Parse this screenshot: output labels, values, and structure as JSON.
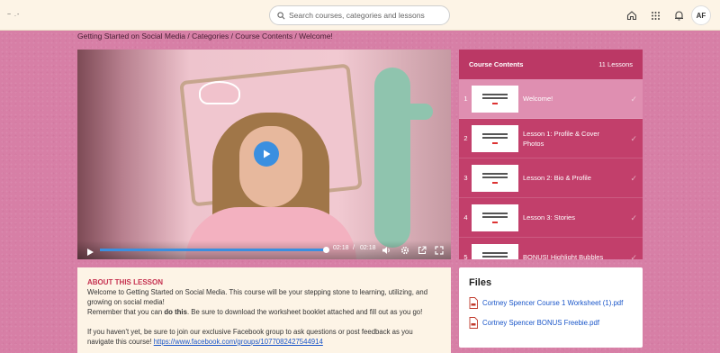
{
  "header": {
    "logo_text": "~ .-",
    "search_placeholder": "Search courses, categories and lessons",
    "avatar_initials": "AF",
    "icons": [
      "home-icon",
      "grid-icon",
      "bell-icon"
    ]
  },
  "breadcrumb": "Getting Started on Social Media / Categories / Course Contents / Welcome!",
  "player": {
    "current_time": "02:18",
    "separator": "/",
    "duration": "02:18",
    "progress": 1.0,
    "accent_color": "#3a8fe0"
  },
  "course_contents": {
    "title": "Course Contents",
    "count": "11 Lessons",
    "lessons": [
      {
        "num": "1",
        "title": "Welcome!",
        "active": true
      },
      {
        "num": "2",
        "title": "Lesson 1: Profile & Cover Photos",
        "active": false
      },
      {
        "num": "3",
        "title": "Lesson 2: Bio & Profile",
        "active": false
      },
      {
        "num": "4",
        "title": "Lesson 3: Stories",
        "active": false
      },
      {
        "num": "5",
        "title": "BONUS! Highlight Bubbles",
        "active": false
      }
    ]
  },
  "about": {
    "title": "ABOUT THIS LESSON",
    "p1": "Welcome to Getting Started on Social Media. This course will be your stepping stone to learning, utilizing, and growing on social media!",
    "p2_pre": "Remember that you can ",
    "p2_bold": "do this",
    "p2_post": ". Be sure to download the worksheet booklet attached and fill out as you go!",
    "p3": "If you haven't yet, be sure to join our exclusive Facebook group to ask questions or post feedback as you navigate this course! ",
    "link": "https://www.facebook.com/groups/1077082427544914"
  },
  "files": {
    "title": "Files",
    "items": [
      {
        "name": "Cortney Spencer Course 1 Worksheet (1).pdf"
      },
      {
        "name": "Cortney Spencer BONUS Freebie.pdf"
      }
    ]
  },
  "colors": {
    "background": "#d77fa6",
    "topbar": "#fdf4e6",
    "contents_panel": "#c23f6b",
    "active_lesson": "#df8fb1",
    "about_title": "#c5304f",
    "link": "#1a56c9"
  }
}
